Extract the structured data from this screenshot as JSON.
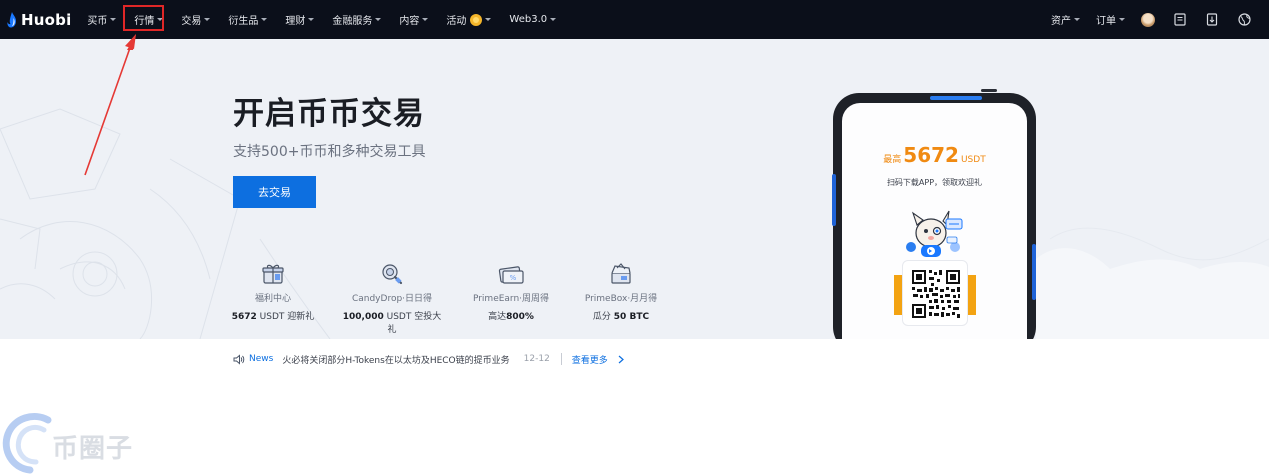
{
  "nav": {
    "logo_text": "Huobi",
    "items": [
      {
        "label": "买币"
      },
      {
        "label": "行情"
      },
      {
        "label": "交易"
      },
      {
        "label": "衍生品"
      },
      {
        "label": "理财"
      },
      {
        "label": "金融服务"
      },
      {
        "label": "内容"
      },
      {
        "label": "活动"
      },
      {
        "label": "Web3.0"
      }
    ],
    "right": {
      "assets": "资产",
      "orders": "订单"
    },
    "icons": [
      "avatar",
      "document-icon",
      "download-icon",
      "globe-icon"
    ],
    "highlight_color": "#e02727"
  },
  "hero": {
    "title": "开启币币交易",
    "subtitle": "支持500+币币和多种交易工具",
    "cta_label": "去交易",
    "features": [
      {
        "icon": "gift-box-icon",
        "name": "福利中心",
        "desc_bold": "5672",
        "desc": " USDT 迎新礼"
      },
      {
        "icon": "magnifier-coin-icon",
        "name": "CandyDrop·日日得",
        "desc_bold": "100,000",
        "desc": " USDT 空投大礼"
      },
      {
        "icon": "ticket-icon",
        "name": "PrimeEarn·周周得",
        "desc_pre": "高达",
        "desc_bold": "800%"
      },
      {
        "icon": "box-icon",
        "name": "PrimeBox·月月得",
        "desc_pre": "瓜分 ",
        "desc_bold": "50 BTC"
      }
    ]
  },
  "phone": {
    "promo_pre": "最高",
    "promo_amount": "5672",
    "promo_unit": "USDT",
    "promo_tip": "扫码下载APP，领取欢迎礼"
  },
  "news": {
    "label": "News",
    "text": "火必将关闭部分H-Tokens在以太坊及HECO链的提币业务",
    "date": "12-12",
    "more": "查看更多"
  },
  "watermark": {
    "text": "币圈子"
  },
  "colors": {
    "accent": "#0d6fe0",
    "nav_bg": "#0b0f1a",
    "hero_bg": "#eef1f6",
    "promo": "#f08a12"
  }
}
